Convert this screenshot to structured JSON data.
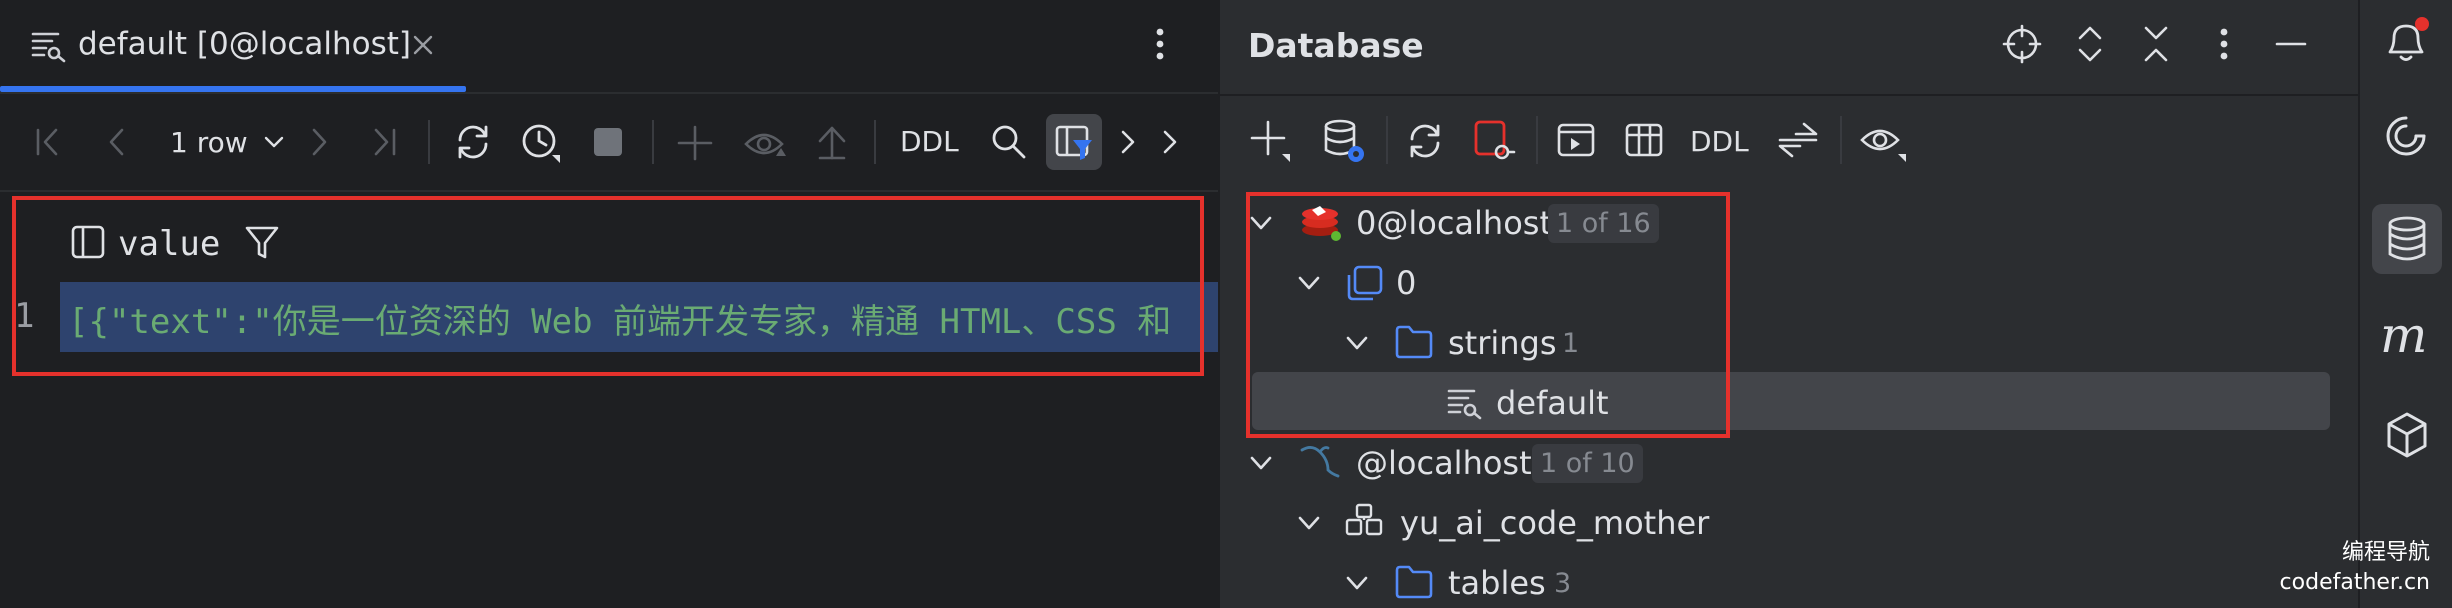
{
  "editor": {
    "tab_title": "default [0@localhost]",
    "toolbar": {
      "rows_label": "1 row",
      "ddl_label": "DDL"
    },
    "grid": {
      "column_header": "value",
      "row_number": "1",
      "cell_value": "[{\"text\":\"你是一位资深的 Web 前端开发专家，精通 HTML、CSS 和"
    }
  },
  "database": {
    "title": "Database",
    "toolbar": {
      "ddl_label": "DDL"
    },
    "tree": [
      {
        "label": "0@localhost",
        "badge": "1 of 16",
        "icon": "redis-icon"
      },
      {
        "label": "0",
        "icon": "database-icon"
      },
      {
        "label": "strings",
        "count": "1",
        "icon": "folder-icon"
      },
      {
        "label": "default",
        "icon": "key-icon"
      },
      {
        "label": "@localhost",
        "badge": "1 of 10",
        "icon": "mysql-icon"
      },
      {
        "label": "yu_ai_code_mother",
        "icon": "schema-icon"
      },
      {
        "label": "tables",
        "count": "3",
        "icon": "folder-icon"
      }
    ]
  },
  "watermark": {
    "line1": "编程导航",
    "line2": "codefather.cn"
  },
  "colors": {
    "background": "#1e1f22",
    "panel": "#2b2d30",
    "accent": "#3574f0",
    "highlight": "#e5312c",
    "string_green": "#6aab73",
    "selection": "#2e436e"
  }
}
